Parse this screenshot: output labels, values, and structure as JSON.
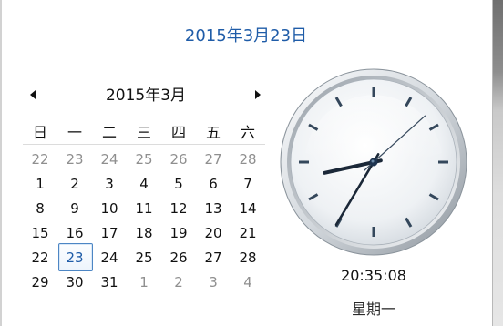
{
  "header": {
    "date_long": "2015年3月23日"
  },
  "calendar": {
    "month_title": "2015年3月",
    "prev_icon": "triangle-left-icon",
    "next_icon": "triangle-right-icon",
    "weekdays": [
      "日",
      "一",
      "二",
      "三",
      "四",
      "五",
      "六"
    ],
    "weeks": [
      [
        {
          "d": "22",
          "muted": true
        },
        {
          "d": "23",
          "muted": true
        },
        {
          "d": "24",
          "muted": true
        },
        {
          "d": "25",
          "muted": true
        },
        {
          "d": "26",
          "muted": true
        },
        {
          "d": "27",
          "muted": true
        },
        {
          "d": "28",
          "muted": true
        }
      ],
      [
        {
          "d": "1"
        },
        {
          "d": "2"
        },
        {
          "d": "3"
        },
        {
          "d": "4"
        },
        {
          "d": "5"
        },
        {
          "d": "6"
        },
        {
          "d": "7"
        }
      ],
      [
        {
          "d": "8"
        },
        {
          "d": "9"
        },
        {
          "d": "10"
        },
        {
          "d": "11"
        },
        {
          "d": "12"
        },
        {
          "d": "13"
        },
        {
          "d": "14"
        }
      ],
      [
        {
          "d": "15"
        },
        {
          "d": "16"
        },
        {
          "d": "17"
        },
        {
          "d": "18"
        },
        {
          "d": "19"
        },
        {
          "d": "20"
        },
        {
          "d": "21"
        }
      ],
      [
        {
          "d": "22"
        },
        {
          "d": "23",
          "selected": true
        },
        {
          "d": "24"
        },
        {
          "d": "25"
        },
        {
          "d": "26"
        },
        {
          "d": "27"
        },
        {
          "d": "28"
        }
      ],
      [
        {
          "d": "29"
        },
        {
          "d": "30"
        },
        {
          "d": "31"
        },
        {
          "d": "1",
          "muted": true
        },
        {
          "d": "2",
          "muted": true
        },
        {
          "d": "3",
          "muted": true
        },
        {
          "d": "4",
          "muted": true
        }
      ]
    ]
  },
  "clock": {
    "time": "20:35:08",
    "weekday": "星期一"
  },
  "colors": {
    "accent": "#1f5ca8",
    "text": "#111111",
    "muted": "#8f8f8f",
    "selected_border": "#4d86c4"
  }
}
